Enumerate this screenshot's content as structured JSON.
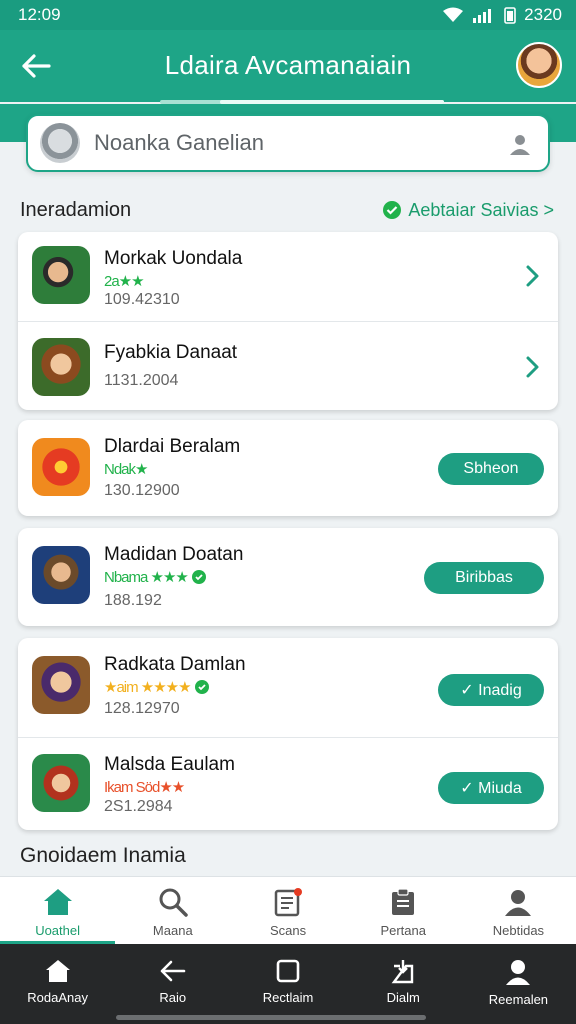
{
  "status_bar": {
    "time": "12:09",
    "right_text": "2320"
  },
  "app_bar": {
    "title": "Ldaira Avcamanaiain"
  },
  "search": {
    "placeholder": "Noanka Ganelian"
  },
  "section": {
    "title": "Ineradamion",
    "see_all": "Aebtaiar Saivias >"
  },
  "games": [
    {
      "name": "Morkak Uondala",
      "rating_text": "2a★★",
      "meta": "109.42310",
      "action": "chevron"
    },
    {
      "name": "Fyabkia Danaat",
      "rating_text": "",
      "meta": "1131.2004",
      "action": "chevron"
    },
    {
      "name": "Dlardai Beralam",
      "rating_text": "Ndak★",
      "meta": "130.12900",
      "action": "Sbheon"
    },
    {
      "name": "Madidan Doatan",
      "rating_text": "Nbama ★★★",
      "meta": "188.192",
      "action": "Biribbas"
    },
    {
      "name": "Radkata Damlan",
      "rating_text": "★aim ★★★★",
      "meta": "128.12970",
      "action": "✓ Inadig"
    },
    {
      "name": "Malsda Eaulam",
      "rating_text": "Ikam Söd★★",
      "meta": "2S1.2984",
      "action": "✓ Miuda"
    }
  ],
  "bottom_section_title": "Gnoidaem Inamia",
  "bottom_nav": [
    {
      "label": "Uoathel",
      "icon": "home-icon",
      "active": true
    },
    {
      "label": "Maana",
      "icon": "search-icon",
      "active": false
    },
    {
      "label": "Scans",
      "icon": "notepad-icon",
      "active": false
    },
    {
      "label": "Pertana",
      "icon": "clipboard-icon",
      "active": false
    },
    {
      "label": "Nebtidas",
      "icon": "profile-icon",
      "active": false
    }
  ],
  "system_nav": [
    {
      "label": "RodaAnay",
      "icon": "house-icon"
    },
    {
      "label": "Raio",
      "icon": "back-arrow-icon"
    },
    {
      "label": "Rectlaim",
      "icon": "square-icon"
    },
    {
      "label": "Dialm",
      "icon": "inbox-icon"
    },
    {
      "label": "Reemalen",
      "icon": "user-icon"
    }
  ],
  "colors": {
    "primary": "#1ea587",
    "accent_green": "#21b24b",
    "dark_nav": "#262829"
  }
}
